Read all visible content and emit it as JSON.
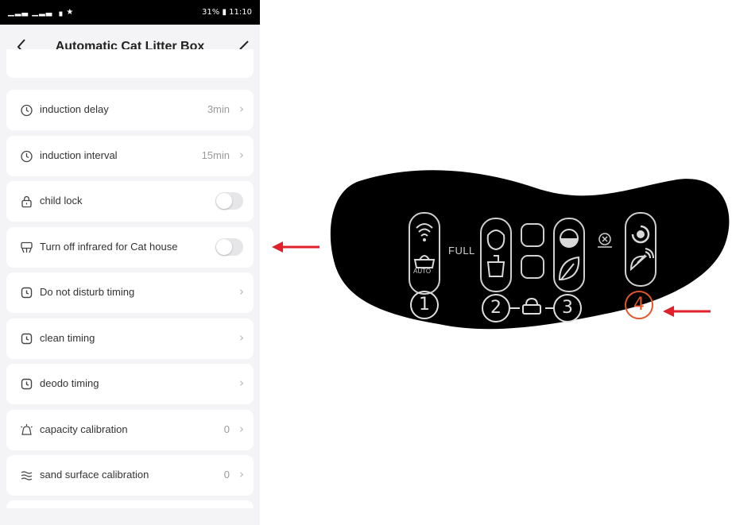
{
  "status_bar": {
    "left": "▁▂▃ ▁▂▃ ▗ ★",
    "right": "31%",
    "time": "11:10"
  },
  "header": {
    "title": "Automatic Cat Litter Box",
    "back_icon": "chevron-left-icon",
    "edit_icon": "edit-icon"
  },
  "settings": [
    {
      "label": "induction delay",
      "value": "3min",
      "icon": "timer-icon",
      "type": "link"
    },
    {
      "label": "induction interval",
      "value": "15min",
      "icon": "timer-icon",
      "type": "link"
    },
    {
      "label": "child lock",
      "icon": "lock-icon",
      "type": "toggle",
      "on": false
    },
    {
      "label": "Turn off infrared for Cat house",
      "icon": "infrared-icon",
      "type": "toggle",
      "on": false
    },
    {
      "label": "Do not disturb timing",
      "icon": "alarm-clock-icon",
      "type": "link"
    },
    {
      "label": "clean timing",
      "icon": "alarm-clock-icon",
      "type": "link"
    },
    {
      "label": "deodo timing",
      "icon": "alarm-clock-icon",
      "type": "link"
    },
    {
      "label": "capacity calibration",
      "value": "0",
      "icon": "bell-icon",
      "type": "link"
    },
    {
      "label": "sand surface calibration",
      "value": "0",
      "icon": "waves-icon",
      "type": "link"
    }
  ],
  "control_panel": {
    "full_label": "FULL",
    "auto_label": "AUTO",
    "buttons": [
      "1",
      "2",
      "3",
      "4"
    ],
    "highlight_color": "#e2572b"
  },
  "colors": {
    "arrow": "#e0202a",
    "panel": "#000000",
    "page_bg": "#f4f4f6"
  }
}
